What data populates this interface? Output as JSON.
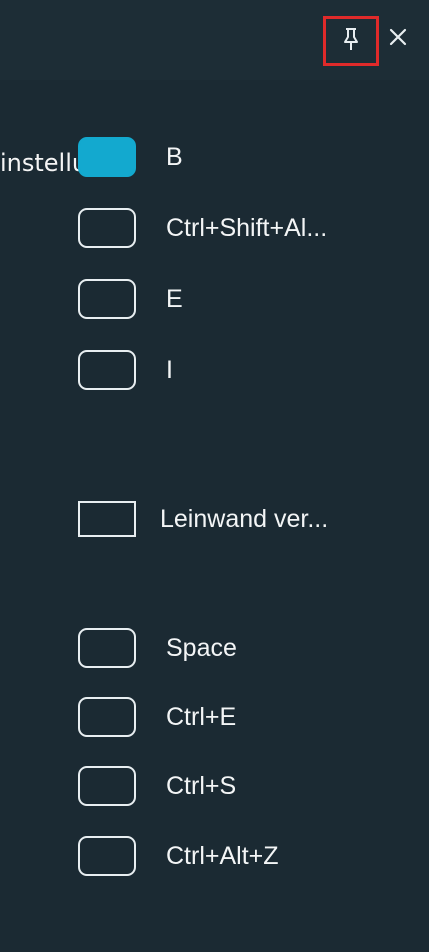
{
  "header": {
    "pin_icon": "pin-icon",
    "close_icon": "close-icon",
    "close_glyph": "×"
  },
  "clipped_label": "instellung",
  "shortcuts_group_1": [
    {
      "label": "B",
      "state": "active"
    },
    {
      "label": "Ctrl+Shift+Al...",
      "state": "inactive"
    },
    {
      "label": "E",
      "state": "inactive"
    },
    {
      "label": "I",
      "state": "inactive"
    }
  ],
  "canvas_option": {
    "label": "Leinwand ver...",
    "state": "inactive"
  },
  "shortcuts_group_2": [
    {
      "label": "Space",
      "state": "inactive"
    },
    {
      "label": "Ctrl+E",
      "state": "inactive"
    },
    {
      "label": "Ctrl+S",
      "state": "inactive"
    },
    {
      "label": "Ctrl+Alt+Z",
      "state": "inactive"
    }
  ],
  "colors": {
    "background": "#1b2a33",
    "accent": "#13a9cf",
    "highlight_border": "#e02a2a"
  }
}
